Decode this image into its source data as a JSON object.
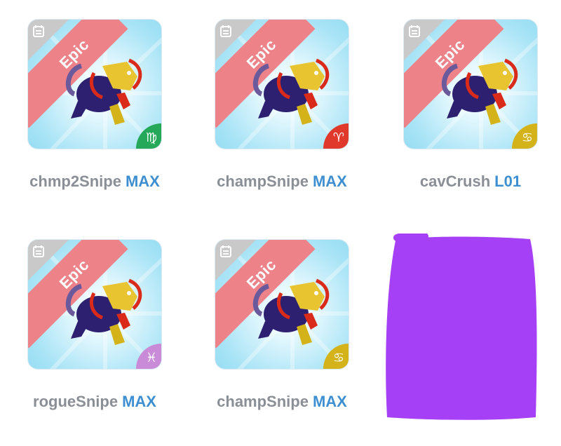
{
  "colors": {
    "rarity_ribbon": "#ee8289",
    "name_text": "#8a8f96",
    "level_text": "#3d8fd1",
    "tile_background": "#a9e4f6",
    "redaction": "#a540f7"
  },
  "cards": [
    {
      "rarity": "Epic",
      "name": "chmp2Snipe",
      "level": "MAX",
      "zodiac_symbol": "♍",
      "zodiac_icon": "virgo-icon",
      "zodiac_color": "#25a85a"
    },
    {
      "rarity": "Epic",
      "name": "champSnipe",
      "level": "MAX",
      "zodiac_symbol": "♈",
      "zodiac_icon": "aries-icon",
      "zodiac_color": "#e0392b"
    },
    {
      "rarity": "Epic",
      "name": "cavCrush",
      "level": "L01",
      "zodiac_symbol": "♋",
      "zodiac_icon": "cancer-icon",
      "zodiac_color": "#d4b21a"
    },
    {
      "rarity": "Epic",
      "name": "rogueSnipe",
      "level": "MAX",
      "zodiac_symbol": "♓",
      "zodiac_icon": "pisces-icon",
      "zodiac_color": "#c98ad8"
    },
    {
      "rarity": "Epic",
      "name": "champSnipe",
      "level": "MAX",
      "zodiac_symbol": "♋",
      "zodiac_icon": "cancer-icon",
      "zodiac_color": "#d4b21a"
    }
  ],
  "redacted_card": {
    "icon": "redaction-scribble"
  }
}
